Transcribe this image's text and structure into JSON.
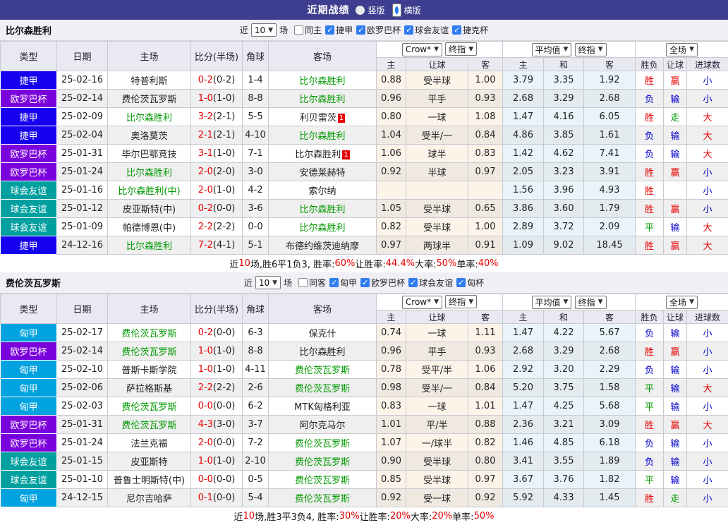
{
  "title_bar": {
    "title": "近期战绩",
    "radios": [
      {
        "label": "竖版",
        "selected": false
      },
      {
        "label": "横版",
        "selected": true
      }
    ]
  },
  "columns": {
    "left": [
      "类型",
      "日期",
      "主场",
      "比分(半场)",
      "角球",
      "客场"
    ],
    "sub": [
      "主",
      "让球",
      "客",
      "主",
      "和",
      "客",
      "胜负",
      "让球",
      "进球数"
    ]
  },
  "dropdowns": {
    "book": "Crow*",
    "final1": "终指",
    "average": "平均值",
    "final2": "终指",
    "fulltime": "全场"
  },
  "league_colors": {
    "czech_league": "#1600EF",
    "europa_league": "#7A00DC",
    "club_friendly": "#00A0A0",
    "hungarian_league": "#00A3DF"
  },
  "status_colors": {
    "red": "#E60000",
    "blue": "#0000CC",
    "green": "#009900"
  },
  "tables": [
    {
      "team": "比尔森胜利",
      "filter": {
        "near": "近",
        "count": "10",
        "unit": "场",
        "checkboxes": [
          {
            "label": "同主",
            "checked": false
          },
          {
            "label": "捷甲",
            "checked": true
          },
          {
            "label": "欧罗巴杯",
            "checked": true
          },
          {
            "label": "球会友谊",
            "checked": true
          },
          {
            "label": "捷克杯",
            "checked": true
          }
        ]
      },
      "rows": [
        {
          "type": {
            "t": "捷甲",
            "bg": "#1600EF"
          },
          "date": "25-02-16",
          "home": {
            "t": "特普利斯"
          },
          "score": {
            "ft": "0-2",
            "ht": "(0-2)"
          },
          "corner": "1-4",
          "away": {
            "t": "比尔森胜利",
            "g": 1
          },
          "odds": [
            "0.88",
            "受半球",
            "1.00"
          ],
          "avg": [
            "3.79",
            "3.35",
            "1.92"
          ],
          "res": [
            [
              "胜",
              "r"
            ],
            [
              "赢",
              "r"
            ],
            [
              "小",
              "b"
            ]
          ]
        },
        {
          "type": {
            "t": "欧罗巴杯",
            "bg": "#7A00DC"
          },
          "date": "25-02-14",
          "home": {
            "t": "费伦茨瓦罗斯"
          },
          "score": {
            "ft": "1-0",
            "ht": "(1-0)"
          },
          "corner": "8-8",
          "away": {
            "t": "比尔森胜利",
            "g": 1
          },
          "odds": [
            "0.96",
            "平手",
            "0.93"
          ],
          "avg": [
            "2.68",
            "3.29",
            "2.68"
          ],
          "res": [
            [
              "负",
              "b"
            ],
            [
              "输",
              "b"
            ],
            [
              "小",
              "b"
            ]
          ]
        },
        {
          "type": {
            "t": "捷甲",
            "bg": "#1600EF"
          },
          "date": "25-02-09",
          "home": {
            "t": "比尔森胜利",
            "g": 1
          },
          "score": {
            "ft": "3-2",
            "ht": "(2-1)"
          },
          "corner": "5-5",
          "away": {
            "t": "利贝雷茨",
            "badge": "1"
          },
          "odds": [
            "0.80",
            "一球",
            "1.08"
          ],
          "avg": [
            "1.47",
            "4.16",
            "6.05"
          ],
          "res": [
            [
              "胜",
              "r"
            ],
            [
              "走",
              "g"
            ],
            [
              "大",
              "r"
            ]
          ]
        },
        {
          "type": {
            "t": "捷甲",
            "bg": "#1600EF"
          },
          "date": "25-02-04",
          "home": {
            "t": "奥洛莫茨"
          },
          "score": {
            "ft": "2-1",
            "ht": "(2-1)"
          },
          "corner": "4-10",
          "away": {
            "t": "比尔森胜利",
            "g": 1
          },
          "odds": [
            "1.04",
            "受半/一",
            "0.84"
          ],
          "avg": [
            "4.86",
            "3.85",
            "1.61"
          ],
          "res": [
            [
              "负",
              "b"
            ],
            [
              "输",
              "b"
            ],
            [
              "大",
              "r"
            ]
          ]
        },
        {
          "type": {
            "t": "欧罗巴杯",
            "bg": "#7A00DC"
          },
          "date": "25-01-31",
          "home": {
            "t": "毕尔巴鄂竞技"
          },
          "score": {
            "ft": "3-1",
            "ht": "(1-0)"
          },
          "corner": "7-1",
          "away": {
            "t": "比尔森胜利",
            "badge": "1"
          },
          "odds": [
            "1.06",
            "球半",
            "0.83"
          ],
          "avg": [
            "1.42",
            "4.62",
            "7.41"
          ],
          "res": [
            [
              "负",
              "b"
            ],
            [
              "输",
              "b"
            ],
            [
              "大",
              "r"
            ]
          ]
        },
        {
          "type": {
            "t": "欧罗巴杯",
            "bg": "#7A00DC"
          },
          "date": "25-01-24",
          "home": {
            "t": "比尔森胜利",
            "g": 1
          },
          "score": {
            "ft": "2-0",
            "ht": "(2-0)"
          },
          "corner": "3-0",
          "away": {
            "t": "安德莱赫特"
          },
          "odds": [
            "0.92",
            "半球",
            "0.97"
          ],
          "avg": [
            "2.05",
            "3.23",
            "3.91"
          ],
          "res": [
            [
              "胜",
              "r"
            ],
            [
              "赢",
              "r"
            ],
            [
              "小",
              "b"
            ]
          ]
        },
        {
          "type": {
            "t": "球会友谊",
            "bg": "#00A0A0"
          },
          "date": "25-01-16",
          "home": {
            "t": "比尔森胜利(中)",
            "g": 1
          },
          "score": {
            "ft": "2-0",
            "ht": "(1-0)"
          },
          "corner": "4-2",
          "away": {
            "t": "索尔纳"
          },
          "odds": [
            "",
            "",
            ""
          ],
          "avg": [
            "1.56",
            "3.96",
            "4.93"
          ],
          "res": [
            [
              "胜",
              "r"
            ],
            [
              "",
              ""
            ],
            [
              "小",
              "b"
            ]
          ]
        },
        {
          "type": {
            "t": "球会友谊",
            "bg": "#00A0A0"
          },
          "date": "25-01-12",
          "home": {
            "t": "皮亚斯特(中)"
          },
          "score": {
            "ft": "0-2",
            "ht": "(0-0)"
          },
          "corner": "3-6",
          "away": {
            "t": "比尔森胜利",
            "g": 1
          },
          "odds": [
            "1.05",
            "受半球",
            "0.65"
          ],
          "avg": [
            "3.86",
            "3.60",
            "1.79"
          ],
          "res": [
            [
              "胜",
              "r"
            ],
            [
              "赢",
              "r"
            ],
            [
              "小",
              "b"
            ]
          ]
        },
        {
          "type": {
            "t": "球会友谊",
            "bg": "#00A0A0"
          },
          "date": "25-01-09",
          "home": {
            "t": "帕德博恩(中)"
          },
          "score": {
            "ft": "2-2",
            "ht": "(2-2)"
          },
          "corner": "0-0",
          "away": {
            "t": "比尔森胜利",
            "g": 1
          },
          "odds": [
            "0.82",
            "受半球",
            "1.00"
          ],
          "avg": [
            "2.89",
            "3.72",
            "2.09"
          ],
          "res": [
            [
              "平",
              "g"
            ],
            [
              "输",
              "b"
            ],
            [
              "大",
              "r"
            ]
          ]
        },
        {
          "type": {
            "t": "捷甲",
            "bg": "#1600EF"
          },
          "date": "24-12-16",
          "home": {
            "t": "比尔森胜利",
            "g": 1
          },
          "score": {
            "ft": "7-2",
            "ht": "(4-1)"
          },
          "corner": "5-1",
          "away": {
            "t": "布德约维茨迪纳摩"
          },
          "odds": [
            "0.97",
            "两球半",
            "0.91"
          ],
          "avg": [
            "1.09",
            "9.02",
            "18.45"
          ],
          "res": [
            [
              "胜",
              "r"
            ],
            [
              "赢",
              "r"
            ],
            [
              "大",
              "r"
            ]
          ]
        }
      ],
      "summary": [
        [
          "近",
          ""
        ],
        [
          "10",
          "r"
        ],
        [
          "场,胜6平1负3, 胜率:",
          ""
        ],
        [
          "60%",
          "r"
        ],
        [
          " 让胜率:",
          ""
        ],
        [
          "44.4%",
          "r"
        ],
        [
          " 大率:",
          ""
        ],
        [
          "50%",
          "r"
        ],
        [
          " 单率:",
          ""
        ],
        [
          "40%",
          "r"
        ]
      ]
    },
    {
      "team": "费伦茨瓦罗斯",
      "filter": {
        "near": "近",
        "count": "10",
        "unit": "场",
        "checkboxes": [
          {
            "label": "同客",
            "checked": false
          },
          {
            "label": "匈甲",
            "checked": true
          },
          {
            "label": "欧罗巴杯",
            "checked": true
          },
          {
            "label": "球会友谊",
            "checked": true
          },
          {
            "label": "匈杯",
            "checked": true
          }
        ]
      },
      "rows": [
        {
          "type": {
            "t": "匈甲",
            "bg": "#00A3DF"
          },
          "date": "25-02-17",
          "home": {
            "t": "费伦茨瓦罗斯",
            "g": 1
          },
          "score": {
            "ft": "0-2",
            "ht": "(0-0)"
          },
          "corner": "6-3",
          "away": {
            "t": "保克什"
          },
          "odds": [
            "0.74",
            "一球",
            "1.11"
          ],
          "avg": [
            "1.47",
            "4.22",
            "5.67"
          ],
          "res": [
            [
              "负",
              "b"
            ],
            [
              "输",
              "b"
            ],
            [
              "小",
              "b"
            ]
          ]
        },
        {
          "type": {
            "t": "欧罗巴杯",
            "bg": "#7A00DC"
          },
          "date": "25-02-14",
          "home": {
            "t": "费伦茨瓦罗斯",
            "g": 1
          },
          "score": {
            "ft": "1-0",
            "ht": "(1-0)"
          },
          "corner": "8-8",
          "away": {
            "t": "比尔森胜利"
          },
          "odds": [
            "0.96",
            "平手",
            "0.93"
          ],
          "avg": [
            "2.68",
            "3.29",
            "2.68"
          ],
          "res": [
            [
              "胜",
              "r"
            ],
            [
              "赢",
              "r"
            ],
            [
              "小",
              "b"
            ]
          ]
        },
        {
          "type": {
            "t": "匈甲",
            "bg": "#00A3DF"
          },
          "date": "25-02-10",
          "home": {
            "t": "普斯卡斯学院"
          },
          "score": {
            "ft": "1-0",
            "ht": "(1-0)"
          },
          "corner": "4-11",
          "away": {
            "t": "费伦茨瓦罗斯",
            "g": 1
          },
          "odds": [
            "0.78",
            "受平/半",
            "1.06"
          ],
          "avg": [
            "2.92",
            "3.20",
            "2.29"
          ],
          "res": [
            [
              "负",
              "b"
            ],
            [
              "输",
              "b"
            ],
            [
              "小",
              "b"
            ]
          ]
        },
        {
          "type": {
            "t": "匈甲",
            "bg": "#00A3DF"
          },
          "date": "25-02-06",
          "home": {
            "t": "萨拉格斯基"
          },
          "score": {
            "ft": "2-2",
            "ht": "(2-2)"
          },
          "corner": "2-6",
          "away": {
            "t": "费伦茨瓦罗斯",
            "g": 1
          },
          "odds": [
            "0.98",
            "受半/一",
            "0.84"
          ],
          "avg": [
            "5.20",
            "3.75",
            "1.58"
          ],
          "res": [
            [
              "平",
              "g"
            ],
            [
              "输",
              "b"
            ],
            [
              "大",
              "r"
            ]
          ]
        },
        {
          "type": {
            "t": "匈甲",
            "bg": "#00A3DF"
          },
          "date": "25-02-03",
          "home": {
            "t": "费伦茨瓦罗斯",
            "g": 1
          },
          "score": {
            "ft": "0-0",
            "ht": "(0-0)"
          },
          "corner": "6-2",
          "away": {
            "t": "MTK匈格利亚"
          },
          "odds": [
            "0.83",
            "一球",
            "1.01"
          ],
          "avg": [
            "1.47",
            "4.25",
            "5.68"
          ],
          "res": [
            [
              "平",
              "g"
            ],
            [
              "输",
              "b"
            ],
            [
              "小",
              "b"
            ]
          ]
        },
        {
          "type": {
            "t": "欧罗巴杯",
            "bg": "#7A00DC"
          },
          "date": "25-01-31",
          "home": {
            "t": "费伦茨瓦罗斯",
            "g": 1
          },
          "score": {
            "ft": "4-3",
            "ht": "(3-0)"
          },
          "corner": "3-7",
          "away": {
            "t": "阿尔克马尔"
          },
          "odds": [
            "1.01",
            "平/半",
            "0.88"
          ],
          "avg": [
            "2.36",
            "3.21",
            "3.09"
          ],
          "res": [
            [
              "胜",
              "r"
            ],
            [
              "赢",
              "r"
            ],
            [
              "大",
              "r"
            ]
          ]
        },
        {
          "type": {
            "t": "欧罗巴杯",
            "bg": "#7A00DC"
          },
          "date": "25-01-24",
          "home": {
            "t": "法兰克福"
          },
          "score": {
            "ft": "2-0",
            "ht": "(0-0)"
          },
          "corner": "7-2",
          "away": {
            "t": "费伦茨瓦罗斯",
            "g": 1
          },
          "odds": [
            "1.07",
            "一/球半",
            "0.82"
          ],
          "avg": [
            "1.46",
            "4.85",
            "6.18"
          ],
          "res": [
            [
              "负",
              "b"
            ],
            [
              "输",
              "b"
            ],
            [
              "小",
              "b"
            ]
          ]
        },
        {
          "type": {
            "t": "球会友谊",
            "bg": "#00A0A0"
          },
          "date": "25-01-15",
          "home": {
            "t": "皮亚斯特"
          },
          "score": {
            "ft": "1-0",
            "ht": "(1-0)"
          },
          "corner": "2-10",
          "away": {
            "t": "费伦茨瓦罗斯",
            "g": 1
          },
          "odds": [
            "0.90",
            "受半球",
            "0.80"
          ],
          "avg": [
            "3.41",
            "3.55",
            "1.89"
          ],
          "res": [
            [
              "负",
              "b"
            ],
            [
              "输",
              "b"
            ],
            [
              "小",
              "b"
            ]
          ]
        },
        {
          "type": {
            "t": "球会友谊",
            "bg": "#00A0A0"
          },
          "date": "25-01-10",
          "home": {
            "t": "普鲁士明斯特(中)"
          },
          "score": {
            "ft": "0-0",
            "ht": "(0-0)"
          },
          "corner": "0-5",
          "away": {
            "t": "费伦茨瓦罗斯",
            "g": 1
          },
          "odds": [
            "0.85",
            "受半球",
            "0.97"
          ],
          "avg": [
            "3.67",
            "3.76",
            "1.82"
          ],
          "res": [
            [
              "平",
              "g"
            ],
            [
              "输",
              "b"
            ],
            [
              "小",
              "b"
            ]
          ]
        },
        {
          "type": {
            "t": "匈甲",
            "bg": "#00A3DF"
          },
          "date": "24-12-15",
          "home": {
            "t": "尼尔吉哈萨"
          },
          "score": {
            "ft": "0-1",
            "ht": "(0-0)"
          },
          "corner": "5-4",
          "away": {
            "t": "费伦茨瓦罗斯",
            "g": 1
          },
          "odds": [
            "0.92",
            "受一球",
            "0.92"
          ],
          "avg": [
            "5.92",
            "4.33",
            "1.45"
          ],
          "res": [
            [
              "胜",
              "r"
            ],
            [
              "走",
              "g"
            ],
            [
              "小",
              "b"
            ]
          ]
        }
      ],
      "summary": [
        [
          "近",
          ""
        ],
        [
          "10",
          "r"
        ],
        [
          "场,胜3平3负4, 胜率:",
          ""
        ],
        [
          "30%",
          "r"
        ],
        [
          " 让胜率:",
          ""
        ],
        [
          "20%",
          "r"
        ],
        [
          " 大率:",
          ""
        ],
        [
          "20%",
          "r"
        ],
        [
          " 单率:",
          ""
        ],
        [
          "50%",
          "r"
        ]
      ]
    }
  ]
}
